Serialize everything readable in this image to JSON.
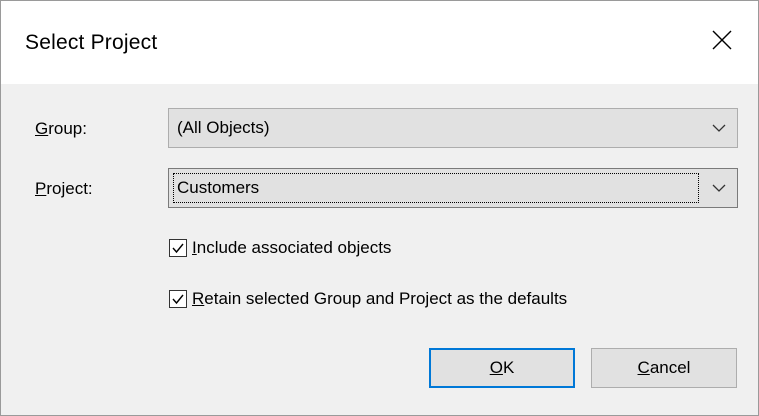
{
  "dialog": {
    "title": "Select Project",
    "close_icon": "close-icon"
  },
  "group": {
    "label_mnemonic": "G",
    "label_rest": "roup:",
    "value": "(All Objects)",
    "icon": "chevron-down-icon"
  },
  "project": {
    "label_mnemonic": "P",
    "label_rest": "roject:",
    "value": "Customers",
    "icon": "chevron-down-icon"
  },
  "options": [
    {
      "checked": true,
      "mnemonic": "I",
      "rest": "nclude associated objects"
    },
    {
      "checked": true,
      "mnemonic": "R",
      "rest": "etain selected Group and Project as the defaults"
    }
  ],
  "buttons": {
    "ok": {
      "mnemonic": "O",
      "rest": "K"
    },
    "cancel": {
      "mnemonic": "C",
      "rest": "ancel"
    }
  },
  "colors": {
    "accent": "#0078d7",
    "button_face": "#e1e1e1",
    "dialog_bg": "#f0f0f0"
  }
}
